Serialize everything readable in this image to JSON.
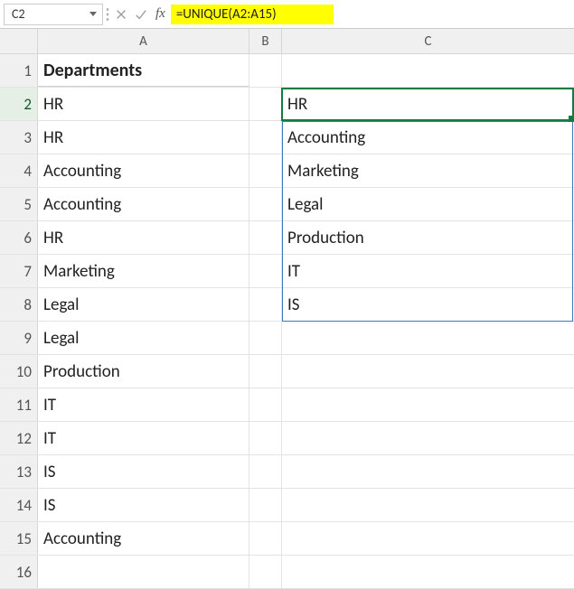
{
  "formula_bar": {
    "name_box_value": "C2",
    "fx_label": "fx",
    "formula": "=UNIQUE(A2:A15)"
  },
  "columns": {
    "A": "A",
    "B": "B",
    "C": "C"
  },
  "header_row": {
    "A": "Departments",
    "B": "",
    "C": ""
  },
  "rows": [
    {
      "n": "1",
      "A": "Departments",
      "B": "",
      "C": ""
    },
    {
      "n": "2",
      "A": "HR",
      "B": "",
      "C": "HR"
    },
    {
      "n": "3",
      "A": "HR",
      "B": "",
      "C": "Accounting"
    },
    {
      "n": "4",
      "A": "Accounting",
      "B": "",
      "C": "Marketing"
    },
    {
      "n": "5",
      "A": "Accounting",
      "B": "",
      "C": "Legal"
    },
    {
      "n": "6",
      "A": "HR",
      "B": "",
      "C": "Production"
    },
    {
      "n": "7",
      "A": "Marketing",
      "B": "",
      "C": "IT"
    },
    {
      "n": "8",
      "A": "Legal",
      "B": "",
      "C": "IS"
    },
    {
      "n": "9",
      "A": "Legal",
      "B": "",
      "C": ""
    },
    {
      "n": "10",
      "A": "Production",
      "B": "",
      "C": ""
    },
    {
      "n": "11",
      "A": "IT",
      "B": "",
      "C": ""
    },
    {
      "n": "12",
      "A": "IT",
      "B": "",
      "C": ""
    },
    {
      "n": "13",
      "A": "IS",
      "B": "",
      "C": ""
    },
    {
      "n": "14",
      "A": "IS",
      "B": "",
      "C": ""
    },
    {
      "n": "15",
      "A": "Accounting",
      "B": "",
      "C": ""
    },
    {
      "n": "16",
      "A": "",
      "B": "",
      "C": ""
    }
  ]
}
